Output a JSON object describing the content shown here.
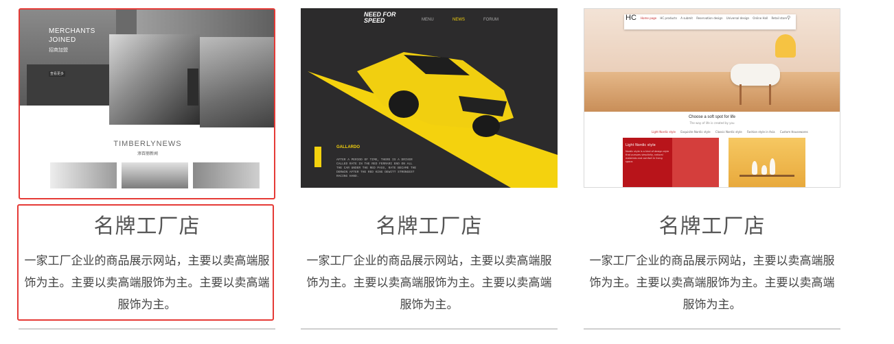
{
  "cards": [
    {
      "title": "名牌工厂店",
      "description": "一家工厂企业的商品展示网站，主要以卖高端服饰为主。主要以卖高端服饰为主。主要以卖高端服饰为主。",
      "preview": {
        "merchants_line1": "MERCHANTS",
        "merchants_line2": "JOINED",
        "merchants_cn": "招商加盟",
        "button": "查看更多",
        "news_title": "TIMBERLYNEWS",
        "news_cn": "添百丽新闻"
      }
    },
    {
      "title": "名牌工厂店",
      "description": "一家工厂企业的商品展示网站，主要以卖高端服饰为主。主要以卖高端服饰为主。主要以卖高端服饰为主。",
      "preview": {
        "logo_line1": "NEED FOR",
        "logo_line2": "SPEED",
        "nav": [
          "MENU",
          "NEWS",
          "FORUM"
        ],
        "car_name": "GALLARDO",
        "copy": "AFTER A PERIOD OF TIME, THERE IS A DRIVER CALLED RATE IN THE RED FERRARI ENO ON ALL THE CAR UNDER THE RED PASS, RATE BECAME THE DERWIN AFTER THE RED KING DEWITT STRONGEST RACING HAND."
      }
    },
    {
      "title": "名牌工厂店",
      "description": "一家工厂企业的商品展示网站，主要以卖高端服饰为主。主要以卖高端服饰为主。主要以卖高端服饰为主。",
      "preview": {
        "logo": "HC",
        "nav": [
          "Home page",
          "HC products",
          "A submit",
          "Reservation design",
          "Universal design",
          "Online Hall",
          "Retail store"
        ],
        "headline": "Choose a soft spot for life",
        "subline": "The way of life is created by you",
        "tabs": [
          "Light Nordic style",
          "Exquisite Nordic style",
          "Classic Nordic style",
          "Fashion style in Asia",
          "Custom Housewares"
        ],
        "panel_title": "Light Nordic style",
        "panel_text": "Nordic style is a kind of design style that pursues simplicity, natural materials and comfort in living space."
      }
    }
  ],
  "colors": {
    "highlight_border": "#e53935",
    "speed_accent": "#f4d20e",
    "hc_red": "#b8141a"
  }
}
